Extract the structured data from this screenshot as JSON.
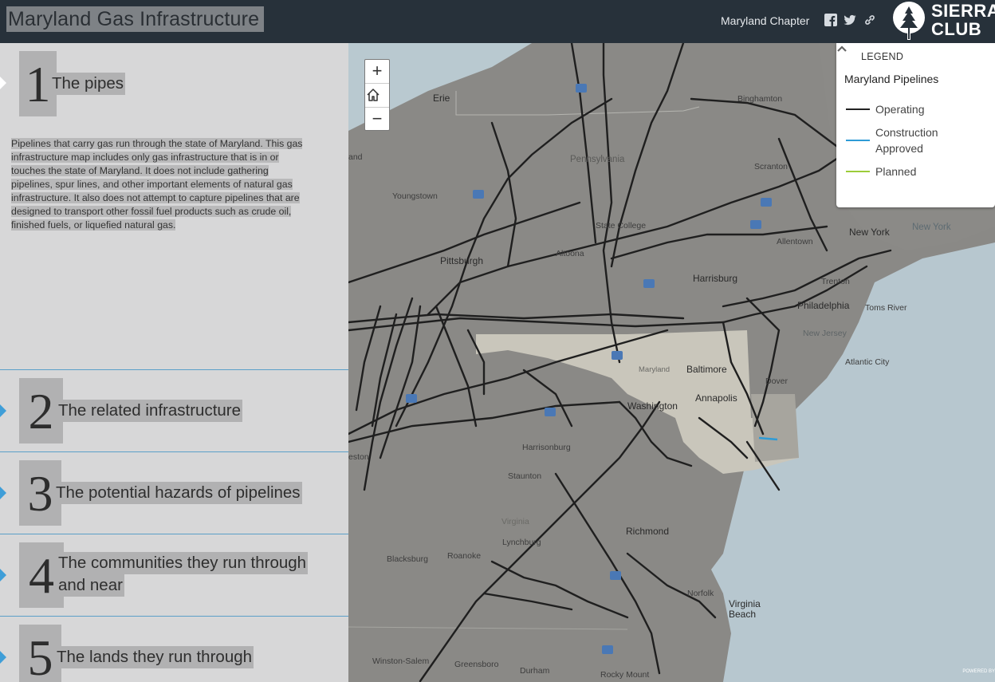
{
  "header": {
    "title": "Maryland Gas Infrastructure",
    "chapter": "Maryland Chapter",
    "logo_text_line1": "SIERRA",
    "logo_text_line2": "CLUB"
  },
  "story": {
    "sections": [
      {
        "number": "1",
        "title": "The pipes"
      },
      {
        "number": "2",
        "title": "The related infrastructure"
      },
      {
        "number": "3",
        "title": "The potential hazards of pipelines"
      },
      {
        "number": "4",
        "title_line1": "The communities they run through",
        "title_line2": "and near"
      },
      {
        "number": "5",
        "title": "The lands they run through"
      }
    ],
    "intro_lines": [
      "Pipelines that carry gas run through the state of Maryland. This gas",
      "infrastructure map includes only gas infrastructure that is in or",
      "touches the state of Maryland. It does not include gathering",
      "pipelines, spur lines, and other important elements of natural gas",
      "infrastructure. It also does not attempt to capture pipelines that are",
      "designed to transport other fossil fuel products such as crude oil,",
      "finished fuels, or liquefied natural gas."
    ]
  },
  "map": {
    "zoom_in": "+",
    "zoom_out": "−",
    "legend": {
      "header": "LEGEND",
      "subtitle": "Maryland Pipelines",
      "items": [
        {
          "label": "Operating",
          "color": "#222222"
        },
        {
          "label_line1": "Construction",
          "label_line2": "Approved",
          "color": "#2e9bd6"
        },
        {
          "label": "Planned",
          "color": "#9ccc3a"
        }
      ]
    },
    "labels": {
      "erie": "Erie",
      "binghamton": "Binghamton",
      "pennsylvania": "Pennsylvania",
      "scranton": "Scranton",
      "youngstown": "Youngstown",
      "state_college": "State College",
      "pittsburgh": "Pittsburgh",
      "altoona": "Altoona",
      "harrisburg": "Harrisburg",
      "reading": "Reading",
      "allentown": "Allentown",
      "new_york": "New York",
      "new_york_2": "New York",
      "trenton": "Trenton",
      "philadelphia": "Philadelphia",
      "toms_river": "Toms River",
      "new_jersey": "New Jersey",
      "atlantic_city": "Atlantic City",
      "baltimore": "Baltimore",
      "maryland": "Maryland",
      "dover": "Dover",
      "annapolis": "Annapolis",
      "washington": "Washington",
      "harrisonburg": "Harrisonburg",
      "staunton": "Staunton",
      "virginia": "Virginia",
      "richmond": "Richmond",
      "lynchburg": "Lynchburg",
      "blacksburg": "Blacksburg",
      "roanoke": "Roanoke",
      "norfolk": "Norfolk",
      "virginia_beach": "Virginia Beach",
      "winston_salem": "Winston-Salem",
      "greensboro": "Greensboro",
      "durham": "Durham",
      "rocky_mount": "Rocky Mount",
      "charleston": "eston",
      "cleveland": "and",
      "oakville": "ille"
    },
    "attribution": "POWERED BY"
  },
  "colors": {
    "header_bg": "#27313a",
    "panel_bg": "#d7d7d8",
    "accent": "#3f9ed8",
    "water": "#b9cad3",
    "land": "#8a8986"
  }
}
